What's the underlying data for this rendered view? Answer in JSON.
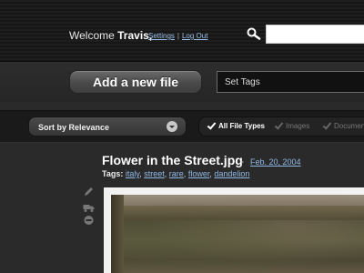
{
  "header": {
    "welcome_prefix": "Welcome",
    "username": "Travis,",
    "settings_link": "Settings",
    "separator": "|",
    "logout_link": "Log Out",
    "search_icon": "magnifier-icon",
    "search_value": ""
  },
  "actions": {
    "add_file_label": "Add a new file",
    "tags_placeholder": "Set Tags"
  },
  "filters": {
    "sort_label": "Sort by Relevance",
    "file_types": [
      {
        "label": "All File Types",
        "checked": true
      },
      {
        "label": "Images",
        "checked": true
      },
      {
        "label": "Documents",
        "checked": true
      }
    ]
  },
  "file": {
    "title": "Flower in the Street.jpg",
    "dash": "-",
    "date": "Feb. 20, 2004",
    "tags_label": "Tags:",
    "tags": [
      "italy",
      "street",
      "rare",
      "flower",
      "dandelion"
    ],
    "tag_sep": ","
  },
  "colors": {
    "link": "#8fb9e6",
    "background": "#2a2a2a"
  }
}
